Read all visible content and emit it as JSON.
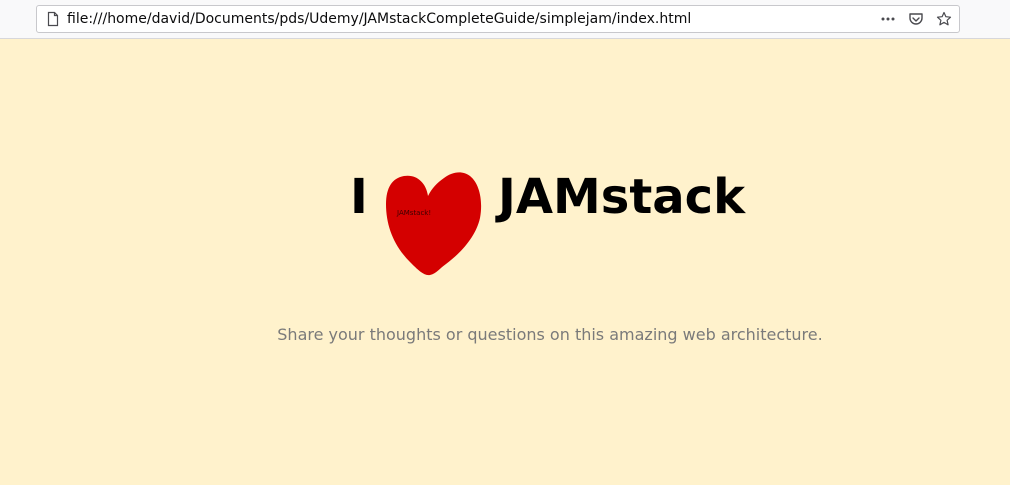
{
  "browser": {
    "url": "file:///home/david/Documents/pds/Udemy/JAMstackCompleteGuide/simplejam/index.html",
    "icons": {
      "page": "page-icon",
      "more": "more-actions-icon",
      "pocket": "pocket-icon",
      "bookmark": "bookmark-star-icon"
    }
  },
  "hero": {
    "word_before": "I",
    "heart_label": "JAMstack!",
    "heart_color": "#d40000",
    "word_after": "JAMstack"
  },
  "subtitle": "Share your thoughts or questions on this amazing web architecture.",
  "colors": {
    "background": "#fff2cc",
    "subtitle": "#7a7a7a"
  }
}
